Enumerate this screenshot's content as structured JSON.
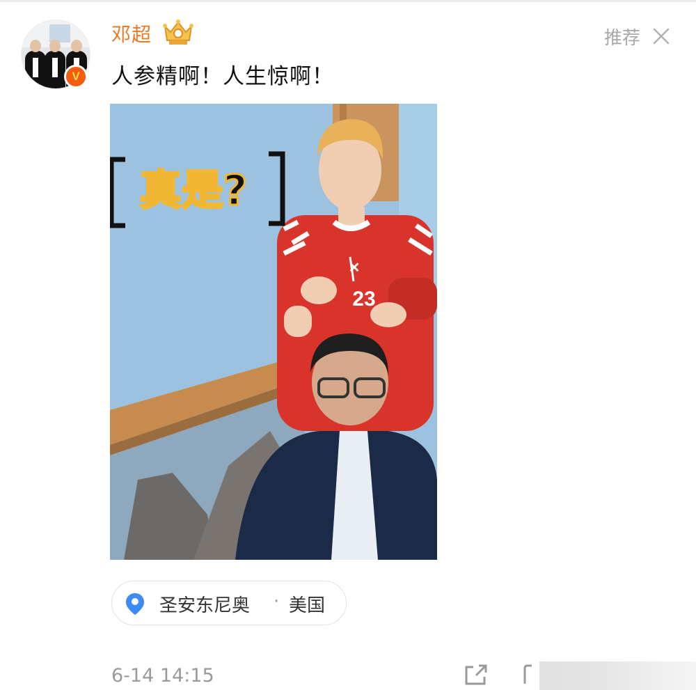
{
  "post": {
    "username": "邓超",
    "recommend_label": "推荐",
    "text": "人参精啊！人生惊啊！",
    "verified_badge": "V",
    "media": {
      "caption": "真是?",
      "jersey_number": "23"
    },
    "location": {
      "city": "圣安东尼奥",
      "separator": "·",
      "country": "美国"
    },
    "timestamp": "6-14 14:15"
  },
  "icons": {
    "crown": "crown-badge-icon",
    "close": "close-icon",
    "location": "location-pin-icon",
    "share": "share-icon",
    "comment": "comment-icon"
  },
  "colors": {
    "username": "#e97b25",
    "verified": "#f45c0e",
    "location_pin": "#3d8af7",
    "muted": "#9a9a9a"
  }
}
